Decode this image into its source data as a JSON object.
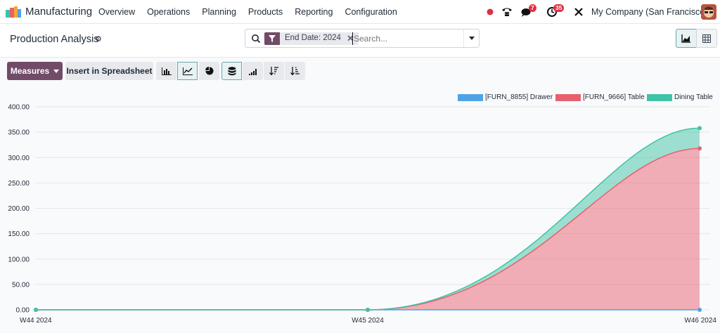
{
  "navbar": {
    "app_name": "Manufacturing",
    "menu": [
      "Overview",
      "Operations",
      "Planning",
      "Products",
      "Reporting",
      "Configuration"
    ],
    "messages_count": "7",
    "activities_count": "35",
    "company": "My Company (San Francisco)"
  },
  "control_panel": {
    "title": "Production Analysis",
    "facet_label": "End Date: 2024",
    "search_placeholder": "Search..."
  },
  "toolbar": {
    "measures_label": "Measures",
    "insert_label": "Insert in Spreadsheet"
  },
  "colors": {
    "brand": "#714b67",
    "series_drawer": "#4ea3e6",
    "series_table": "#e8606f",
    "series_dining": "#3fc3a6"
  },
  "chart_data": {
    "type": "area",
    "stacked": true,
    "categories": [
      "W44 2024",
      "W45 2024",
      "W46 2024"
    ],
    "series": [
      {
        "name": "[FURN_8855] Drawer",
        "values": [
          0,
          0,
          0
        ]
      },
      {
        "name": "[FURN_9666] Table",
        "values": [
          0,
          0,
          318
        ]
      },
      {
        "name": "Dining Table",
        "values": [
          0,
          0,
          40
        ]
      }
    ],
    "y_ticks": [
      "0.00",
      "50.00",
      "100.00",
      "150.00",
      "200.00",
      "250.00",
      "300.00",
      "350.00",
      "400.00"
    ],
    "ylim": [
      0,
      400
    ],
    "legend_position": "top-right",
    "grid": true
  }
}
